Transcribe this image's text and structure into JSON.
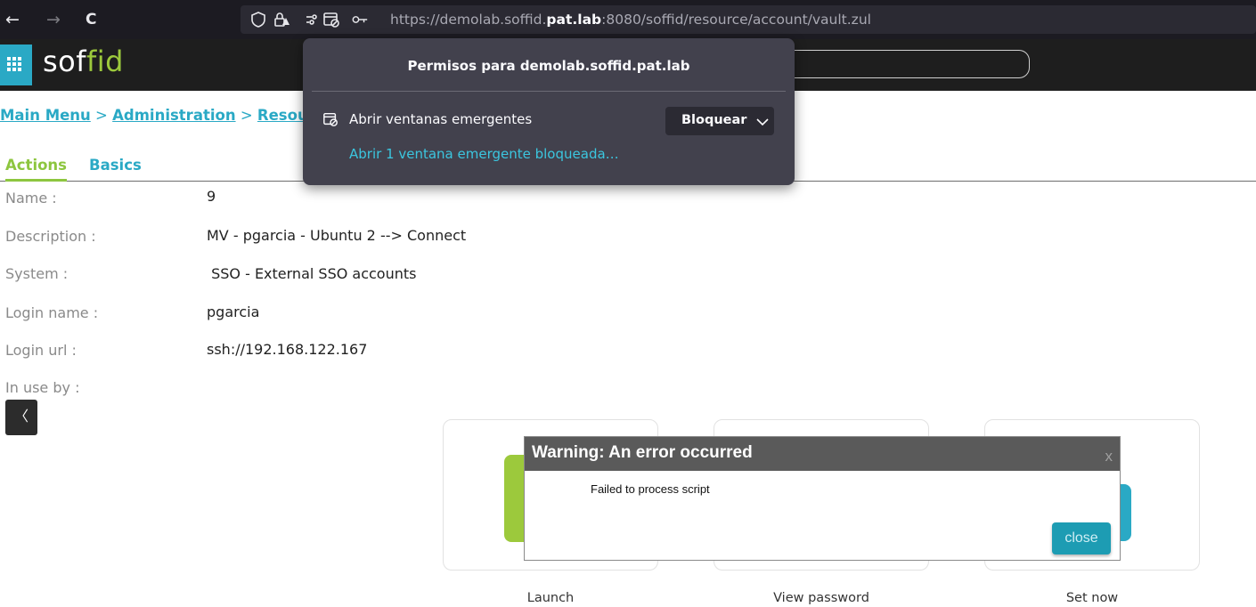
{
  "browser": {
    "back_glyph": "←",
    "forward_glyph": "→",
    "reload_glyph": "C",
    "url_prefix": "https://demolab.soffid.",
    "url_host_bold": "pat.lab",
    "url_suffix": ":8080/soffid/resource/account/vault.zul",
    "icons": [
      "shield-icon",
      "lock-warning-icon",
      "permissions-icon",
      "blocked-popup-icon",
      "key-icon"
    ]
  },
  "app": {
    "logo_prefix": "sof",
    "logo_suffix": "fid",
    "brand_blue": "#2aa9c5",
    "brand_green": "#9cc93c"
  },
  "breadcrumb": {
    "main_menu": "Main Menu",
    "sep1": " > ",
    "administration": "Administration",
    "sep2": " > ",
    "resources_partial": "Resour"
  },
  "tabs": [
    {
      "label": "Actions",
      "active": true
    },
    {
      "label": "Basics",
      "active": false
    }
  ],
  "form": {
    "name_label": "Name :",
    "name_value": "9",
    "description_label": "Description :",
    "description_value": "MV - pgarcia - Ubuntu 2 --> Connect",
    "system_label": "System :",
    "system_value": " SSO - External SSO accounts",
    "login_name_label": "Login name :",
    "login_name_value": "pgarcia",
    "login_url_label": "Login url :",
    "login_url_value": "ssh://192.168.122.167",
    "in_use_by_label": "In use by :",
    "back_glyph": "〈"
  },
  "actions": [
    {
      "label": "Launch"
    },
    {
      "label": "View password"
    },
    {
      "label": "Set now"
    }
  ],
  "dialog": {
    "title": "Warning: An error occurred",
    "close_x": "x",
    "message": "Failed to process script",
    "close_button": "close"
  },
  "permissions_popup": {
    "title": "Permisos para demolab.soffid.pat.lab",
    "permission_label": "Abrir ventanas emergentes",
    "select_value": "Bloquear",
    "link_text": "Abrir 1 ventana emergente bloqueada…"
  }
}
